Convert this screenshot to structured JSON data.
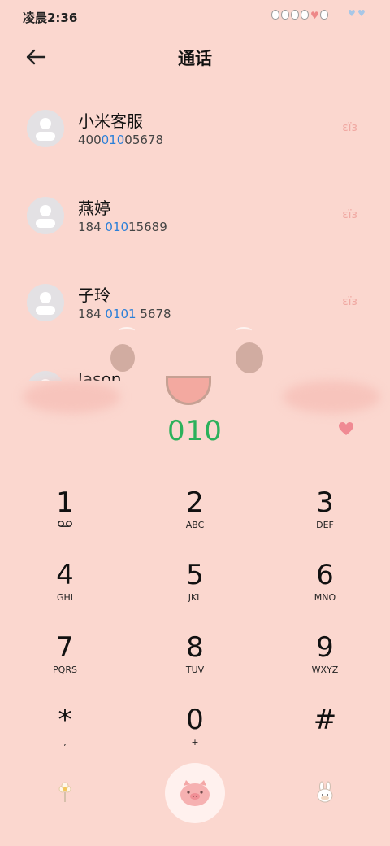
{
  "status": {
    "time": "凌晨2:36"
  },
  "header": {
    "title": "通话"
  },
  "contacts": [
    {
      "name": "小米客服",
      "number_parts": [
        "400",
        "010",
        "05678"
      ],
      "deco": "εїз"
    },
    {
      "name": "燕婷",
      "number_parts": [
        "184 ",
        "010",
        "15689"
      ],
      "deco": "εїз"
    },
    {
      "name": "子玲",
      "number_parts": [
        "184 ",
        "0101",
        " 5678"
      ],
      "deco": "εїз"
    },
    {
      "name": "Jason",
      "number_parts": [
        "",
        "",
        ""
      ],
      "deco": ""
    }
  ],
  "dialer": {
    "dialed": "010",
    "keys": [
      {
        "digit": "1",
        "letters": "voicemail"
      },
      {
        "digit": "2",
        "letters": "ABC"
      },
      {
        "digit": "3",
        "letters": "DEF"
      },
      {
        "digit": "4",
        "letters": "GHI"
      },
      {
        "digit": "5",
        "letters": "JKL"
      },
      {
        "digit": "6",
        "letters": "MNO"
      },
      {
        "digit": "7",
        "letters": "PQRS"
      },
      {
        "digit": "8",
        "letters": "TUV"
      },
      {
        "digit": "9",
        "letters": "WXYZ"
      },
      {
        "digit": "*",
        "letters": ","
      },
      {
        "digit": "0",
        "letters": "+"
      },
      {
        "digit": "#",
        "letters": ""
      }
    ]
  },
  "icons": {
    "back": "back-arrow-icon",
    "favorite": "heart-icon",
    "call": "pig-call-icon",
    "left_action": "flower-icon",
    "right_action": "bunny-icon"
  },
  "colors": {
    "background": "#fbd7cf",
    "dialed_number": "#2cb15b",
    "highlight": "#2b7fd8",
    "heart": "#f08a93"
  }
}
